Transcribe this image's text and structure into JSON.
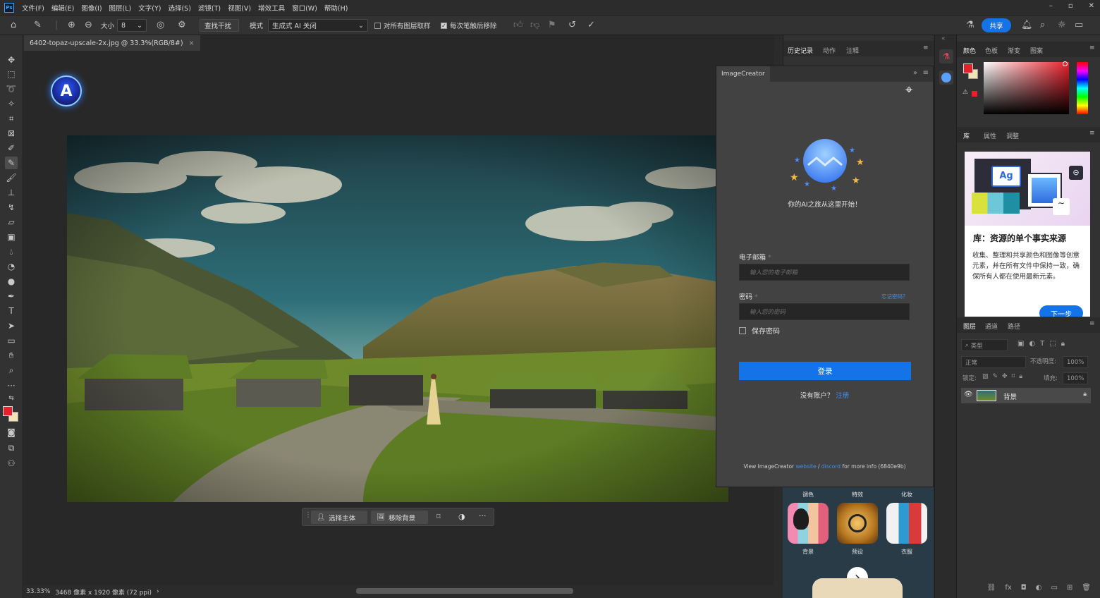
{
  "app": {
    "logo": "Ps"
  },
  "menu": [
    "文件(F)",
    "编辑(E)",
    "图像(I)",
    "图层(L)",
    "文字(Y)",
    "选择(S)",
    "滤镜(T)",
    "视图(V)",
    "增效工具",
    "窗口(W)",
    "帮助(H)"
  ],
  "window_controls": {
    "minimize": "–",
    "restore": "▫",
    "close": "✕"
  },
  "options": {
    "size_label": "大小",
    "size_value": "8",
    "find_interference": "查找干扰",
    "mode_label": "模式",
    "mode_value": "生成式 AI 关闭",
    "sample_all_layers": "对所有图层取样",
    "remove_after_each": "每次笔触后移除",
    "share": "共享"
  },
  "document": {
    "tab": "6402-topaz-upscale-2x.jpg @ 33.3%(RGB/8#)",
    "close": "×"
  },
  "taskbar": {
    "select_subject": "选择主体",
    "remove_bg": "移除背景",
    "more": "···"
  },
  "status": {
    "zoom": "33.33%",
    "dims": "3468 像素 x 1920 像素 (72 ppi)",
    "arrow": "›"
  },
  "history_panel": {
    "tabs": [
      "历史记录",
      "动作",
      "注释"
    ]
  },
  "imagecreator": {
    "title": "ImageCreator",
    "tagline": "你的AI之旅从这里开始！",
    "email_label": "电子邮箱",
    "email_placeholder": "输入您的电子邮箱",
    "password_label": "密码",
    "forgot": "忘记密码？",
    "password_placeholder": "输入您的密码",
    "remember": "保存密码",
    "login": "登录",
    "no_account": "没有账户？",
    "register": "注册",
    "footer_pre": "View ImageCreator ",
    "footer_website": "website",
    "footer_sep": " / ",
    "footer_discord": "discord",
    "footer_post": " for more info (6840e9b)",
    "required": "*"
  },
  "thumbs": {
    "headers": [
      "调色",
      "特效",
      "化妆"
    ],
    "labels": [
      "背景",
      "预设",
      "衣服"
    ],
    "next": "›"
  },
  "color_panel": {
    "tabs": [
      "颜色",
      "色板",
      "渐变",
      "图案"
    ]
  },
  "library_panel": {
    "tabs": [
      "库",
      "属性",
      "调整"
    ],
    "card_badge": "Ag",
    "card_title": "库：资源的单个事实来源",
    "card_body": "收集、整理和共享颜色和图像等创意元素，并在所有文件中保持一致，确保所有人都在使用最新元素。",
    "next": "下一步"
  },
  "layers_panel": {
    "tabs": [
      "图层",
      "通道",
      "路径"
    ],
    "filter_label": "类型",
    "blend_mode": "正常",
    "opacity_label": "不透明度:",
    "opacity_value": "100%",
    "lock_label": "锁定:",
    "fill_label": "填充:",
    "fill_value": "100%",
    "layer_name": "背景"
  },
  "colors": {
    "accent": "#1473e6",
    "foreground": "#e8202c",
    "background": "#f3e3b8",
    "link": "#3d8ef0"
  }
}
